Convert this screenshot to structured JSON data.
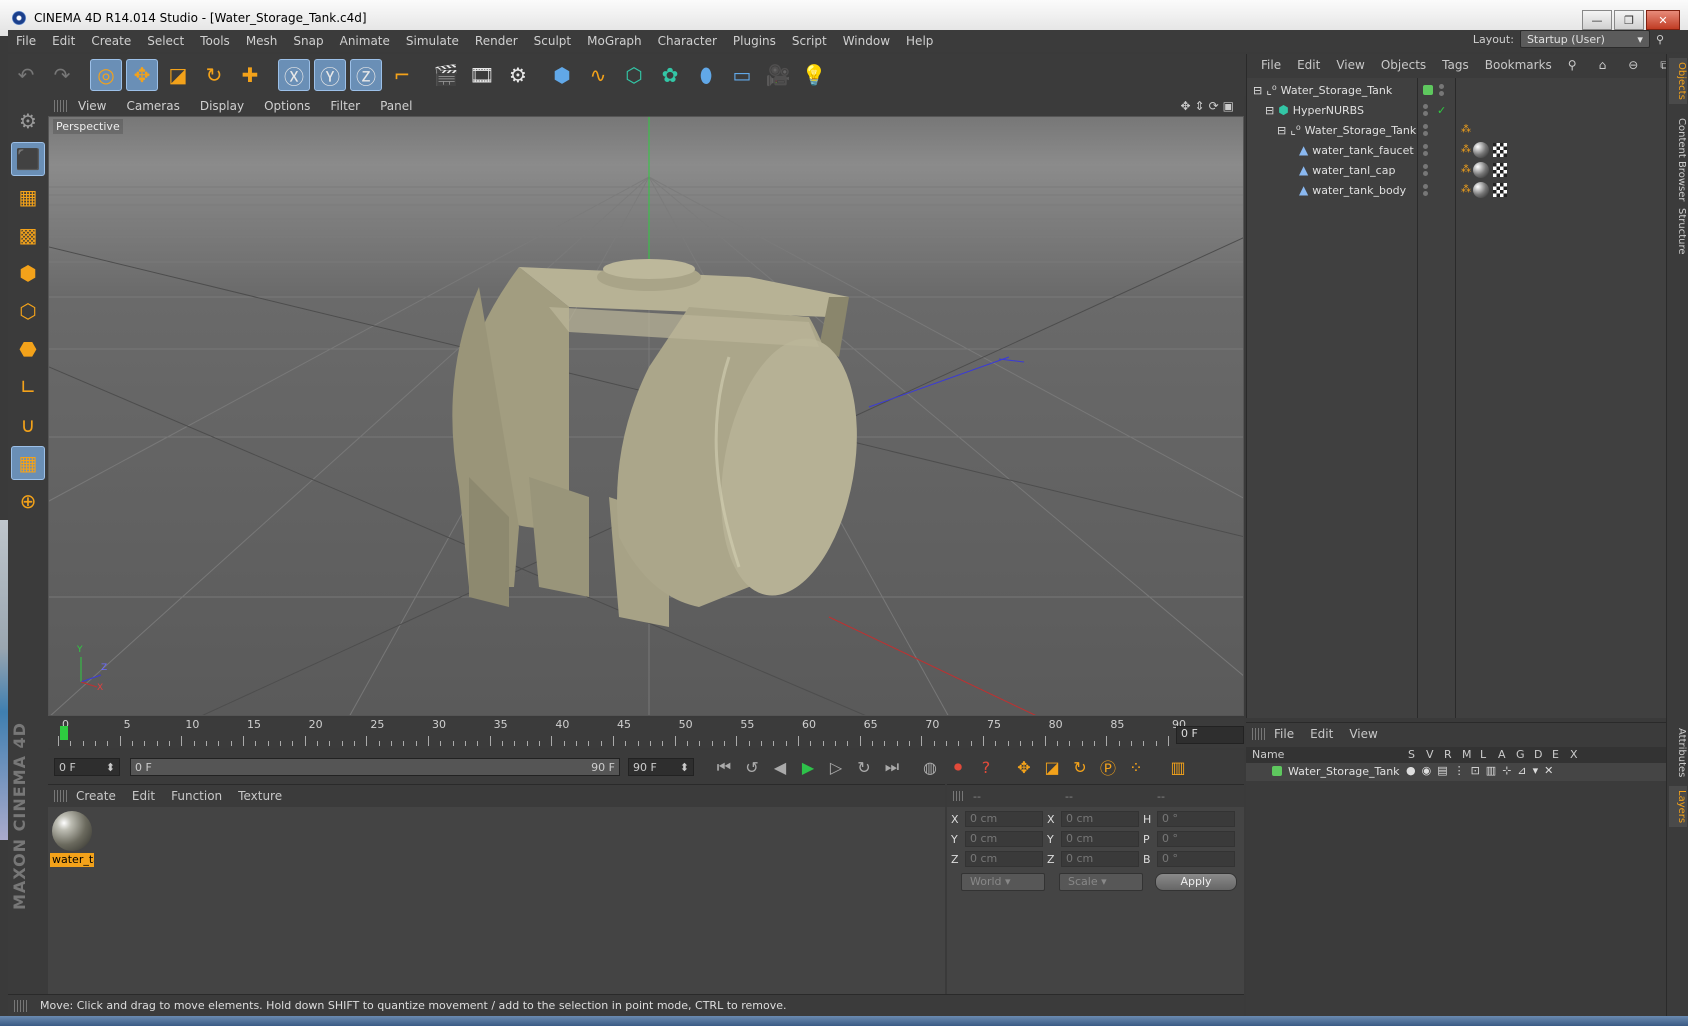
{
  "window": {
    "title": "CINEMA 4D R14.014 Studio - [Water_Storage_Tank.c4d]",
    "buttons": {
      "minimize": "—",
      "restore": "❐",
      "close": "✕"
    }
  },
  "menubar": {
    "items": [
      "File",
      "Edit",
      "Create",
      "Select",
      "Tools",
      "Mesh",
      "Snap",
      "Animate",
      "Simulate",
      "Render",
      "Sculpt",
      "MoGraph",
      "Character",
      "Plugins",
      "Script",
      "Window",
      "Help"
    ],
    "layout_label": "Layout:",
    "layout_value": "Startup (User)"
  },
  "toolbar": {
    "icons": [
      "undo-icon",
      "redo-icon",
      "live-selection-icon",
      "move-icon",
      "scale-icon",
      "rotate-icon",
      "add-icon",
      "x-axis-icon",
      "y-axis-icon",
      "z-axis-icon",
      "coordinate-system-icon",
      "render-view-icon",
      "render-picture-viewer-icon",
      "edit-render-settings-icon",
      "cube-icon",
      "spline-icon",
      "nurbs-icon",
      "array-icon",
      "deformer-icon",
      "floor-icon",
      "camera-icon",
      "light-icon"
    ]
  },
  "viewport": {
    "menu": [
      "View",
      "Cameras",
      "Display",
      "Options",
      "Filter",
      "Panel"
    ],
    "label": "Perspective",
    "axis_labels": {
      "y": "Y",
      "z": "Z",
      "x": "X"
    },
    "object_color": "#a9a488"
  },
  "timeline": {
    "ticks": [
      "0",
      "5",
      "10",
      "15",
      "20",
      "25",
      "30",
      "35",
      "40",
      "45",
      "50",
      "55",
      "60",
      "65",
      "70",
      "75",
      "80",
      "85",
      "90"
    ],
    "current_frame": "0 F",
    "start_field": "0 F",
    "range_start": "0 F",
    "range_end": "90 F",
    "end_field": "90 F"
  },
  "material_manager": {
    "menu": [
      "Create",
      "Edit",
      "Function",
      "Texture"
    ],
    "materials": [
      {
        "name": "water_ta"
      }
    ]
  },
  "coordinates": {
    "headers": [
      "--",
      "--",
      "--"
    ],
    "rows": [
      {
        "a": "X",
        "a_val": "0 cm",
        "b": "X",
        "b_val": "0 cm",
        "c": "H",
        "c_val": "0 °"
      },
      {
        "a": "Y",
        "a_val": "0 cm",
        "b": "Y",
        "b_val": "0 cm",
        "c": "P",
        "c_val": "0 °"
      },
      {
        "a": "Z",
        "a_val": "0 cm",
        "b": "Z",
        "b_val": "0 cm",
        "c": "B",
        "c_val": "0 °"
      }
    ],
    "world_label": "World",
    "scale_label": "Scale",
    "apply_label": "Apply"
  },
  "object_manager": {
    "menu": [
      "File",
      "Edit",
      "View",
      "Objects",
      "Tags",
      "Bookmarks"
    ],
    "objects": [
      {
        "name": "Water_Storage_Tank",
        "icon": "null-icon"
      },
      {
        "name": "HyperNURBS",
        "icon": "hypernurbs-icon"
      },
      {
        "name": "Water_Storage_Tank",
        "icon": "null-icon"
      },
      {
        "name": "water_tank_faucet",
        "icon": "polygon-icon"
      },
      {
        "name": "water_tanl_cap",
        "icon": "polygon-icon"
      },
      {
        "name": "water_tank_body",
        "icon": "polygon-icon"
      }
    ]
  },
  "layer_manager": {
    "menu": [
      "File",
      "Edit",
      "View"
    ],
    "columns": [
      "Name",
      "S",
      "V",
      "R",
      "M",
      "L",
      "A",
      "G",
      "D",
      "E",
      "X"
    ],
    "layers": [
      {
        "name": "Water_Storage_Tank",
        "color": "#5ec85e"
      }
    ]
  },
  "side_tabs": [
    "Objects",
    "Content Browser",
    "Structure",
    "Attributes",
    "Layers"
  ],
  "status": {
    "text": "Move: Click and drag to move elements. Hold down SHIFT to quantize movement / add to the selection in point mode, CTRL to remove."
  },
  "branding": {
    "text": "MAXON CINEMA 4D"
  }
}
